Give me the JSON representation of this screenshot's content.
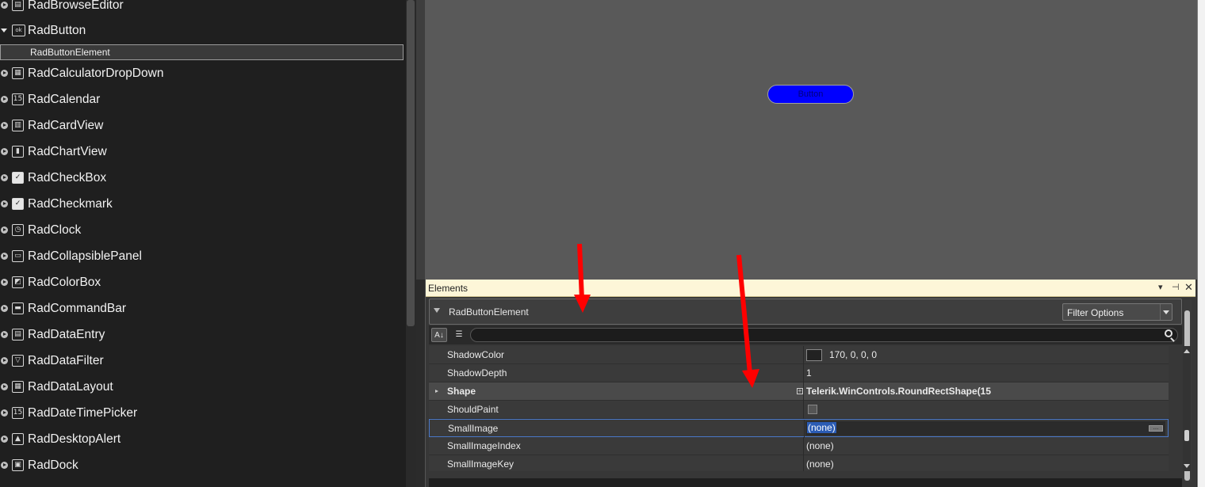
{
  "tree": {
    "items": [
      {
        "label": "RadBrowseEditor",
        "icon": "browse-icon",
        "glyph": "▤"
      },
      {
        "label": "RadButton",
        "icon": "button-icon",
        "glyph": "ok",
        "expanded": true
      },
      {
        "label": "RadCalculatorDropDown",
        "icon": "calculator-icon",
        "glyph": "▦"
      },
      {
        "label": "RadCalendar",
        "icon": "calendar-icon",
        "glyph": "15"
      },
      {
        "label": "RadCardView",
        "icon": "cardview-icon",
        "glyph": "▥"
      },
      {
        "label": "RadChartView",
        "icon": "chart-icon",
        "glyph": "▮"
      },
      {
        "label": "RadCheckBox",
        "icon": "checkbox-icon",
        "glyph": "✓"
      },
      {
        "label": "RadCheckmark",
        "icon": "checkmark-icon",
        "glyph": "✓"
      },
      {
        "label": "RadClock",
        "icon": "clock-icon",
        "glyph": "◷"
      },
      {
        "label": "RadCollapsiblePanel",
        "icon": "panel-icon",
        "glyph": "▭"
      },
      {
        "label": "RadColorBox",
        "icon": "colorbox-icon",
        "glyph": "◩"
      },
      {
        "label": "RadCommandBar",
        "icon": "commandbar-icon",
        "glyph": "▬"
      },
      {
        "label": "RadDataEntry",
        "icon": "dataentry-icon",
        "glyph": "▤"
      },
      {
        "label": "RadDataFilter",
        "icon": "filter-icon",
        "glyph": "▽"
      },
      {
        "label": "RadDataLayout",
        "icon": "datalayout-icon",
        "glyph": "▦"
      },
      {
        "label": "RadDateTimePicker",
        "icon": "datetime-icon",
        "glyph": "15"
      },
      {
        "label": "RadDesktopAlert",
        "icon": "alert-icon",
        "glyph": "▲"
      },
      {
        "label": "RadDock",
        "icon": "dock-icon",
        "glyph": "▣"
      }
    ],
    "selected_child": "RadButtonElement"
  },
  "preview": {
    "button_label": "Button",
    "button_color": "#0000ff"
  },
  "elements": {
    "title": "Elements",
    "element_name": "RadButtonElement",
    "filter_label": "Filter Options",
    "sort_icon": "sort-az-icon",
    "category_icon": "categorize-icon",
    "properties": [
      {
        "name": "ShadowColor",
        "value": "170, 0, 0, 0",
        "kind": "color"
      },
      {
        "name": "ShadowDepth",
        "value": "1",
        "kind": "text"
      },
      {
        "name": "Shape",
        "value": "Telerik.WinControls.RoundRectShape(15",
        "kind": "category"
      },
      {
        "name": "ShouldPaint",
        "value": "",
        "kind": "check"
      },
      {
        "name": "SmallImage",
        "value": "(none)",
        "kind": "selected"
      },
      {
        "name": "SmallImageIndex",
        "value": "(none)",
        "kind": "text"
      },
      {
        "name": "SmallImageKey",
        "value": "(none)",
        "kind": "text"
      }
    ]
  },
  "colors": {
    "annotation_arrow": "#ff0000",
    "selection": "#2b5cb5"
  }
}
